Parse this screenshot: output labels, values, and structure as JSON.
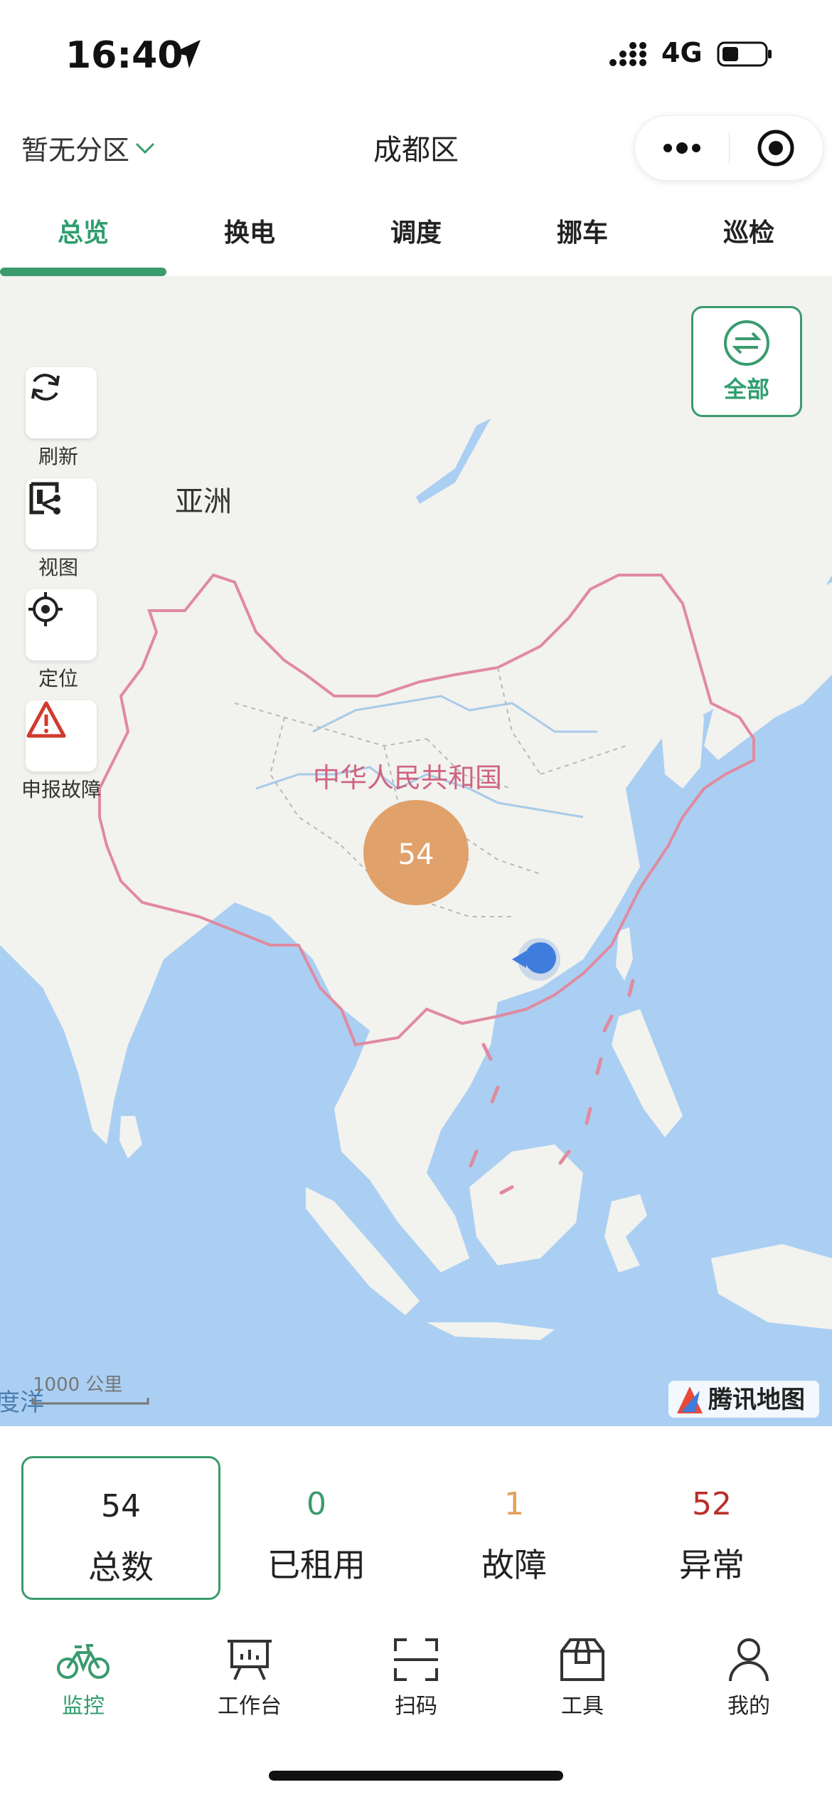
{
  "status_bar": {
    "time": "16:40",
    "network": "4G"
  },
  "header": {
    "zone_selector": "暂无分区",
    "title": "成都区"
  },
  "tabs": [
    {
      "label": "总览",
      "active": true
    },
    {
      "label": "换电",
      "active": false
    },
    {
      "label": "调度",
      "active": false
    },
    {
      "label": "挪车",
      "active": false
    },
    {
      "label": "巡检",
      "active": false
    }
  ],
  "map": {
    "side_buttons": [
      {
        "label": "刷新",
        "icon": "refresh-icon"
      },
      {
        "label": "视图",
        "icon": "view-icon"
      },
      {
        "label": "定位",
        "icon": "locate-icon"
      },
      {
        "label": "申报故障",
        "icon": "warning-icon"
      }
    ],
    "filter_label": "全部",
    "labels": {
      "continent": "亚洲",
      "country": "中华人民共和国",
      "ocean": "度洋",
      "scale": "1000 公里",
      "provider": "腾讯地图"
    },
    "cluster_count": "54"
  },
  "stats": [
    {
      "value": "54",
      "label": "总数",
      "color": "#222222"
    },
    {
      "value": "0",
      "label": "已租用",
      "color": "#3a9b6d"
    },
    {
      "value": "1",
      "label": "故障",
      "color": "#e0a15a"
    },
    {
      "value": "52",
      "label": "异常",
      "color": "#b8302a"
    }
  ],
  "bottom_nav": [
    {
      "label": "监控",
      "icon": "bike-icon",
      "active": true
    },
    {
      "label": "工作台",
      "icon": "workbench-icon",
      "active": false
    },
    {
      "label": "扫码",
      "icon": "scan-icon",
      "active": false
    },
    {
      "label": "工具",
      "icon": "toolbox-icon",
      "active": false
    },
    {
      "label": "我的",
      "icon": "user-icon",
      "active": false
    }
  ],
  "colors": {
    "accent": "#3a9b6d",
    "cluster": "#e09a5f",
    "sea": "#aacff2",
    "land": "#f2f2ef",
    "border": "#e08aa0"
  }
}
